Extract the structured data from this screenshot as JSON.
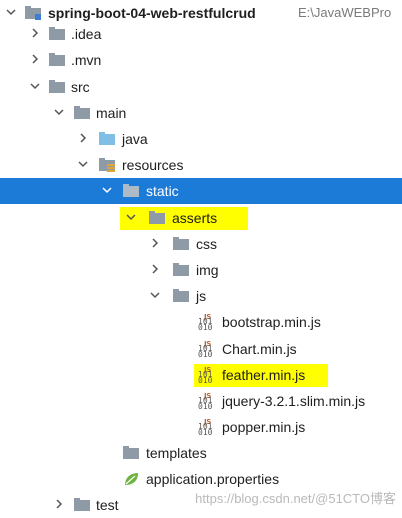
{
  "project": {
    "name": "spring-boot-04-web-restfulcrud",
    "path": "E:\\JavaWEBPro"
  },
  "tree": {
    "idea": ".idea",
    "mvn": ".mvn",
    "src": "src",
    "main": "main",
    "java": "java",
    "resources": "resources",
    "static": "static",
    "asserts": "asserts",
    "css": "css",
    "img": "img",
    "js": "js",
    "files": {
      "bootstrap": "bootstrap.min.js",
      "chart": "Chart.min.js",
      "feather": "feather.min.js",
      "jquery": "jquery-3.2.1.slim.min.js",
      "popper": "popper.min.js"
    },
    "templates": "templates",
    "application_properties": "application.properties",
    "test": "test"
  },
  "colors": {
    "selection": "#1d7bd8",
    "highlight": "#ffff00",
    "folder": "#8e9aa6",
    "source_folder": "#7fbfe6"
  },
  "watermark": "https://blog.csdn.net/@51CTO博客"
}
